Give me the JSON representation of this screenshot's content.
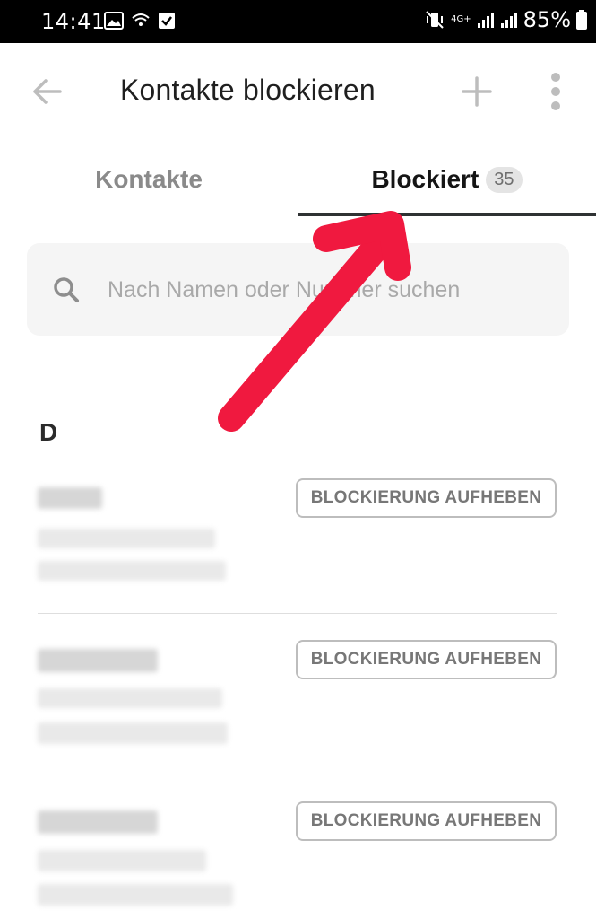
{
  "status_bar": {
    "time": "14:41",
    "battery": "85%",
    "network": "4G+"
  },
  "header": {
    "title": "Kontakte blockieren"
  },
  "tabs": [
    {
      "label": "Kontakte"
    },
    {
      "label": "Blockiert",
      "badge": "35"
    }
  ],
  "search": {
    "placeholder": "Nach Namen oder Nummer suchen"
  },
  "section": {
    "letter": "D"
  },
  "contacts": [
    {
      "button_label": "BLOCKIERUNG AUFHEBEN"
    },
    {
      "button_label": "BLOCKIERUNG AUFHEBEN"
    },
    {
      "button_label": "BLOCKIERUNG AUFHEBEN"
    }
  ],
  "colors": {
    "annotation_arrow": "#f0193f",
    "tab_underline": "#2f3233"
  }
}
